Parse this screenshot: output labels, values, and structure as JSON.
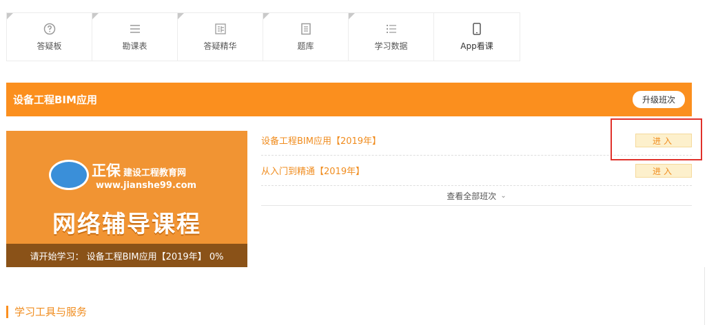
{
  "toolbar": {
    "items": [
      {
        "label": "答疑板",
        "icon": "question-circle-icon"
      },
      {
        "label": "勘课表",
        "icon": "list-lines-icon"
      },
      {
        "label": "答疑精华",
        "icon": "book-glyph-icon"
      },
      {
        "label": "题库",
        "icon": "document-icon"
      },
      {
        "label": "学习数据",
        "icon": "bullet-list-icon"
      },
      {
        "label": "App看课",
        "icon": "mobile-phone-icon"
      }
    ]
  },
  "course": {
    "title": "设备工程BIM应用",
    "upgrade_label": "升级班次",
    "banner": {
      "brand": "正保",
      "brand_sub": "建设工程教育网",
      "url": "www.jianshe99.com",
      "headline": "网络辅导课程",
      "caption": "请开始学习： 设备工程BIM应用【2019年】 0%"
    },
    "classes": [
      {
        "name": "设备工程BIM应用【2019年】",
        "action": "进入"
      },
      {
        "name": "从入门到精通【2019年】",
        "action": "进入"
      }
    ],
    "view_all_label": "查看全部班次"
  },
  "section": {
    "title": "学习工具与服务"
  },
  "colors": {
    "accent": "#fb8f1e",
    "highlight": "#e0302a"
  }
}
